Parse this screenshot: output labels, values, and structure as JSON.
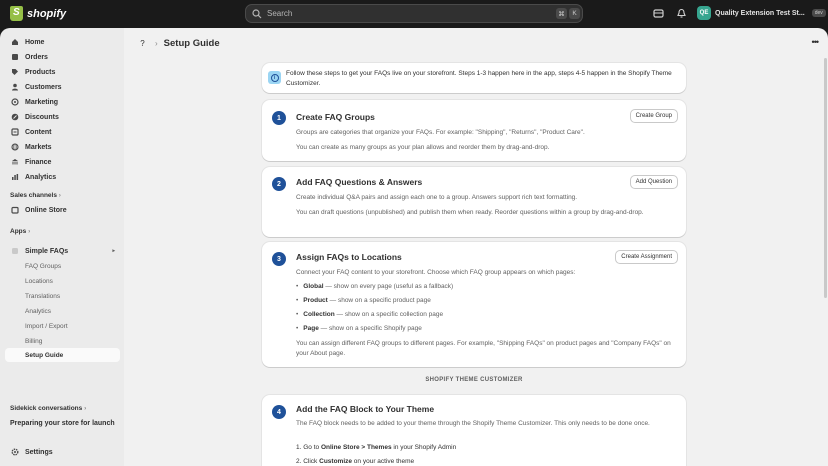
{
  "topbar": {
    "logo_text": "shopify",
    "search_placeholder": "Search",
    "kbd_cmd": "⌘",
    "kbd_k": "K",
    "store_initials": "QE",
    "store_name": "Quality Extension Test St...",
    "store_badge": "dev"
  },
  "sidebar": {
    "items": [
      {
        "label": "Home",
        "icon": "home-icon"
      },
      {
        "label": "Orders",
        "icon": "orders-icon"
      },
      {
        "label": "Products",
        "icon": "tag-icon"
      },
      {
        "label": "Customers",
        "icon": "person-icon"
      },
      {
        "label": "Marketing",
        "icon": "target-icon"
      },
      {
        "label": "Discounts",
        "icon": "discount-icon"
      },
      {
        "label": "Content",
        "icon": "content-icon"
      },
      {
        "label": "Markets",
        "icon": "globe-icon"
      },
      {
        "label": "Finance",
        "icon": "bank-icon"
      },
      {
        "label": "Analytics",
        "icon": "chart-icon"
      }
    ],
    "sales_channels_label": "Sales channels",
    "online_store": "Online Store",
    "apps_label": "Apps",
    "app_name": "Simple FAQs",
    "app_sub_items": [
      "FAQ Groups",
      "Locations",
      "Translations",
      "Analytics",
      "Import / Export",
      "Billing",
      "Setup Guide"
    ],
    "sidekick_label": "Sidekick conversations",
    "sidekick_item": "Preparing your store for launch",
    "settings": "Settings"
  },
  "page": {
    "help": "?",
    "title": "Setup Guide",
    "more": "•••"
  },
  "info": {
    "text": "Follow these steps to get your FAQs live on your storefront. Steps 1-3 happen here in the app, steps 4-5 happen in the Shopify Theme Customizer."
  },
  "steps": [
    {
      "num": "1",
      "title": "Create FAQ Groups",
      "button": "Create Group",
      "p1": "Groups are categories that organize your FAQs. For example: \"Shipping\", \"Returns\", \"Product Care\".",
      "p2": "You can create as many groups as your plan allows and reorder them by drag-and-drop."
    },
    {
      "num": "2",
      "title": "Add FAQ Questions & Answers",
      "button": "Add Question",
      "p1": "Create individual Q&A pairs and assign each one to a group. Answers support rich text formatting.",
      "p2": "You can draft questions (unpublished) and publish them when ready. Reorder questions within a group by drag-and-drop."
    },
    {
      "num": "3",
      "title": "Assign FAQs to Locations",
      "button": "Create Assignment",
      "p1": "Connect your FAQ content to your storefront. Choose which FAQ group appears on which pages:",
      "bullets": [
        {
          "bold": "Global",
          "rest": " — show on every page (useful as a fallback)"
        },
        {
          "bold": "Product",
          "rest": " — show on a specific product page"
        },
        {
          "bold": "Collection",
          "rest": " — show on a specific collection page"
        },
        {
          "bold": "Page",
          "rest": " — show on a specific Shopify page"
        }
      ],
      "p2": "You can assign different FAQ groups to different pages. For example, \"Shipping FAQs\" on product pages and \"Company FAQs\" on your About page."
    },
    {
      "num": "4",
      "title": "Add the FAQ Block to Your Theme",
      "p1": "The FAQ block needs to be added to your theme through the Shopify Theme Customizer. This only needs to be done once.",
      "li1_pre": "1. Go to ",
      "li1_bold": "Online Store > Themes",
      "li1_post": " in your Shopify Admin",
      "li2_pre": "2. Click ",
      "li2_bold": "Customize",
      "li2_post": " on your active theme"
    }
  ],
  "divider_label": "SHOPIFY THEME CUSTOMIZER",
  "colors": {
    "accent": "#1f5199",
    "topbar": "#1a1a1a",
    "sidebar": "#ebebeb",
    "main": "#f1f1f1",
    "store_avatar": "#36a58f"
  }
}
